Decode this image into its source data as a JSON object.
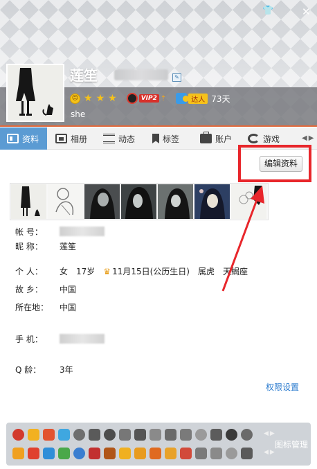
{
  "window": {
    "skin_icon": "tshirt-icon",
    "close_icon": "close-icon"
  },
  "profile": {
    "nickname": "莲笙",
    "level_stars": 3,
    "vip_label": "VIP2",
    "daren_label": "达人",
    "days": "73天",
    "signature": "she"
  },
  "tabs": [
    {
      "label": "资料",
      "icon": "profile-card-icon",
      "active": true
    },
    {
      "label": "相册",
      "icon": "album-icon",
      "active": false
    },
    {
      "label": "动态",
      "icon": "feed-list-icon",
      "active": false
    },
    {
      "label": "标签",
      "icon": "bookmark-icon",
      "active": false
    },
    {
      "label": "账户",
      "icon": "wallet-icon",
      "active": false
    },
    {
      "label": "游戏",
      "icon": "game-icon",
      "active": false
    }
  ],
  "edit_button": "编辑资料",
  "info": {
    "account_label": "帐 号：",
    "nick_label": "昵 称：",
    "nick_value": "莲笙",
    "personal_label": "个 人：",
    "gender": "女",
    "age": "17岁",
    "birthday": "11月15日(公历生日)",
    "zodiac": "属虎",
    "constellation": "天蝎座",
    "hometown_label": "故 乡：",
    "hometown_value": "中国",
    "location_label": "所在地：",
    "location_value": "中国",
    "phone_label": "手 机：",
    "qage_label": "Q 龄：",
    "qage_value": "3年"
  },
  "permission_link": "权限设置",
  "icon_manage": "图标管理",
  "colors": {
    "accent_tab": "#5b9bd3",
    "header_line": "#e2683a",
    "annotation_red": "#e8262b",
    "link_blue": "#2b7bcf"
  }
}
